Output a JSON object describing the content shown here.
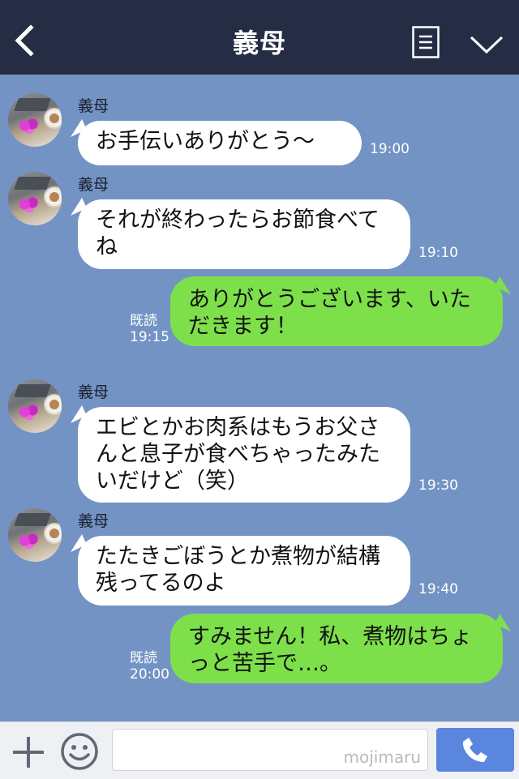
{
  "header": {
    "title": "義母"
  },
  "messages": [
    {
      "sender": "義母",
      "text": "お手伝いありがとう〜",
      "time": "19:00"
    },
    {
      "sender": "義母",
      "text": "それが終わったらお節食べてね",
      "time": "19:10"
    },
    {
      "text": "ありがとうございます、いただきます！",
      "read_label": "既読",
      "time": "19:15"
    },
    {
      "sender": "義母",
      "text": "エビとかお肉系はもうお父さんと息子が食べちゃったみたいだけど（笑）",
      "time": "19:30"
    },
    {
      "sender": "義母",
      "text": "たたきごぼうとか煮物が結構残ってるのよ",
      "time": "19:40"
    },
    {
      "text": "すみません！私、煮物はちょっと苦手で…。",
      "read_label": "既読",
      "time": "20:00"
    }
  ],
  "input": {
    "watermark": "mojimaru"
  },
  "icons": {
    "back": "chevron-left-icon",
    "menu": "menu-list-icon",
    "collapse": "chevron-down-icon",
    "add": "plus-icon",
    "sticker": "smiley-icon",
    "call": "phone-icon"
  },
  "colors": {
    "header": "#252d45",
    "chat_background": "#7393c4",
    "bubble_incoming": "#ffffff",
    "bubble_outgoing": "#7de04a",
    "call_button": "#5a86de"
  }
}
